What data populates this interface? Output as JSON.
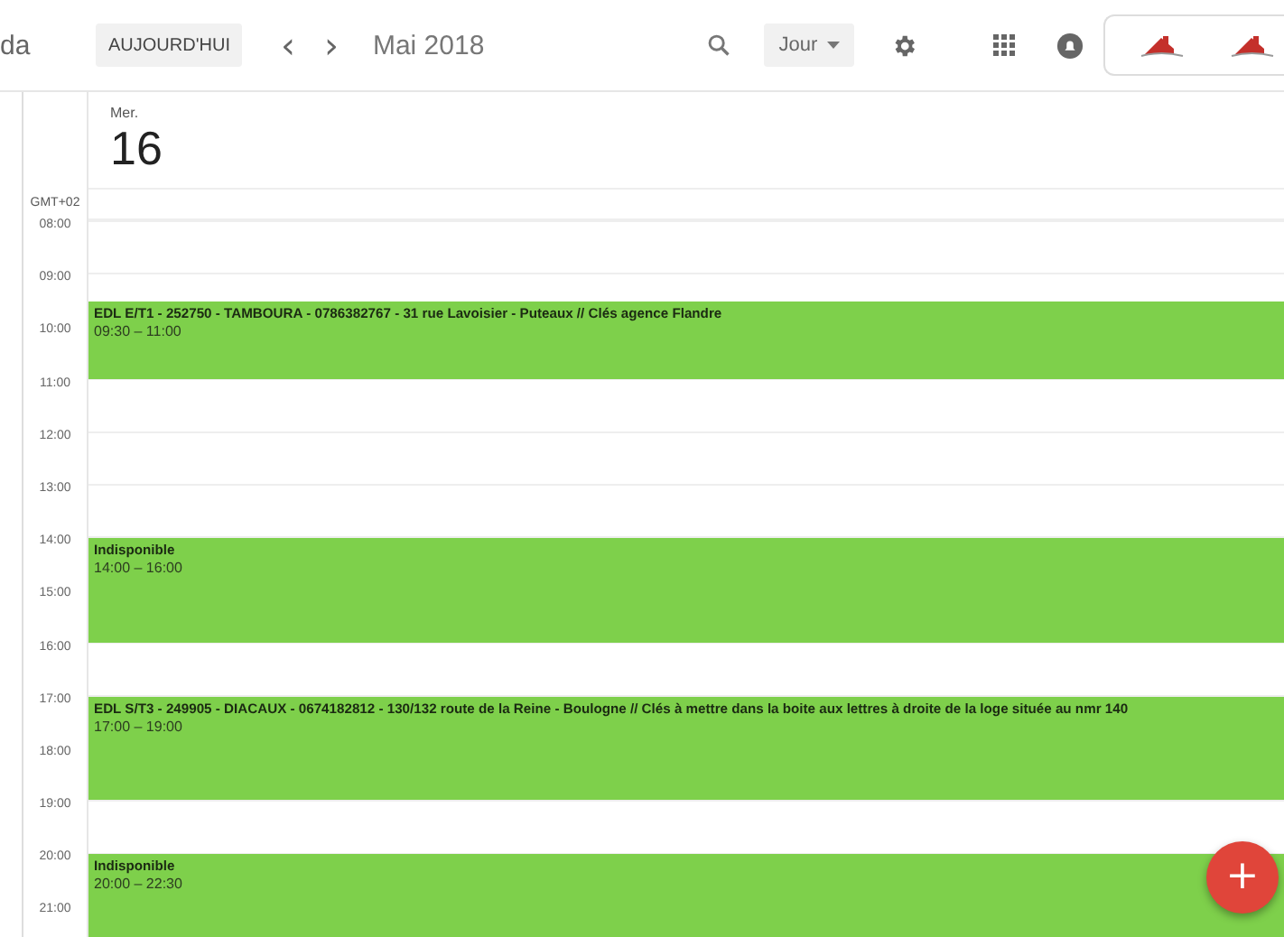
{
  "app_title": "da",
  "toolbar": {
    "today_button": "AUJOURD'HUI",
    "prev": "‹",
    "next": "›",
    "period": "Mai 2018",
    "view_select": "Jour"
  },
  "day": {
    "weekday": "Mer.",
    "date": "16"
  },
  "timezone": "GMT+02",
  "hours": [
    "08:00",
    "09:00",
    "10:00",
    "11:00",
    "12:00",
    "13:00",
    "14:00",
    "15:00",
    "16:00",
    "17:00",
    "18:00",
    "19:00",
    "20:00",
    "21:00"
  ],
  "events": [
    {
      "title": "EDL E/T1 - 252750 - TAMBOURA - 0786382767 - 31 rue Lavoisier - Puteaux // Clés agence Flandre",
      "time": "09:30 – 11:00"
    },
    {
      "title": "Indisponible",
      "time": "14:00 – 16:00"
    },
    {
      "title": "EDL S/T3 - 249905 - DIACAUX - 0674182812 - 130/132 route de la Reine - Boulogne // Clés à mettre dans la boite aux lettres à droite de la loge située au nmr 140",
      "time": "17:00 – 19:00"
    },
    {
      "title": "Indisponible",
      "time": "20:00 – 22:30"
    }
  ],
  "fab": "+"
}
